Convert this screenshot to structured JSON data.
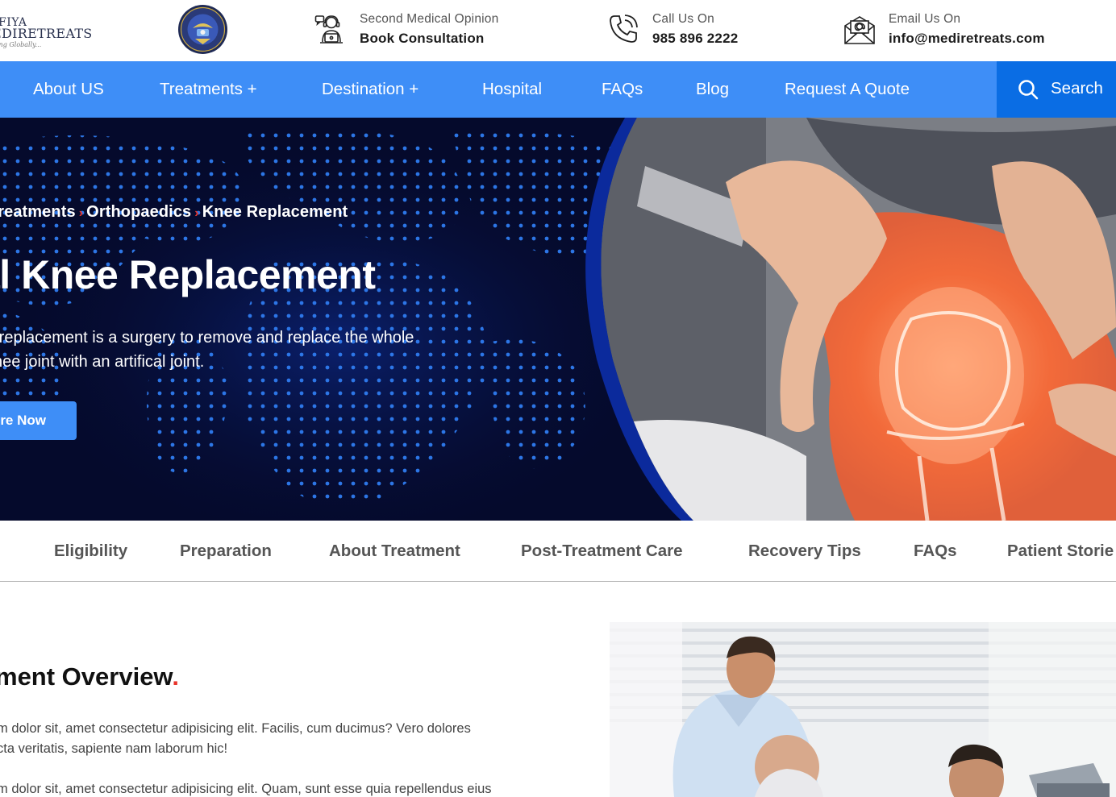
{
  "brand": {
    "logo_lines": [
      "FIYA",
      "EDIRETREATS",
      "ing Globally..."
    ]
  },
  "contacts": [
    {
      "icon": "consultant-icon",
      "label": "Second Medical Opinion",
      "value": "Book Consultation"
    },
    {
      "icon": "phone-icon",
      "label": "Call Us On",
      "value": "985 896 2222"
    },
    {
      "icon": "mail-icon",
      "label": "Email Us On",
      "value": "info@mediretreats.com"
    }
  ],
  "nav": {
    "items": [
      "About US",
      "Treatments +",
      "Destination +",
      "Hospital",
      "FAQs",
      "Blog",
      "Request A Quote"
    ],
    "search_label": "Search"
  },
  "hero": {
    "breadcrumb": [
      "Treatments",
      "Orthopaedics",
      "Knee Replacement"
    ],
    "title": "al Knee Replacement",
    "description_lines": [
      "e replacement is a surgery to remove and replace the whole",
      "knee joint with an artifical joint."
    ],
    "cta_label": "re Now"
  },
  "tabs": [
    "Eligibility",
    "Preparation",
    "About Treatment",
    "Post-Treatment Care",
    "Recovery Tips",
    "FAQs",
    "Patient Storie"
  ],
  "overview": {
    "title": "ment Overview",
    "title_dot": ".",
    "para1_lines": [
      "m dolor sit, amet consectetur adipisicing elit. Facilis, cum ducimus? Vero dolores",
      "cta veritatis, sapiente nam laborum hic!"
    ],
    "para2_lines": [
      "m dolor sit, amet consectetur adipisicing elit. Quam, sunt esse quia repellendus eius"
    ]
  },
  "colors": {
    "nav_bg": "#3e8ef7",
    "search_bg": "#0a6de4",
    "hero_bg": "#050a2c",
    "accent_red": "#e8332a"
  }
}
